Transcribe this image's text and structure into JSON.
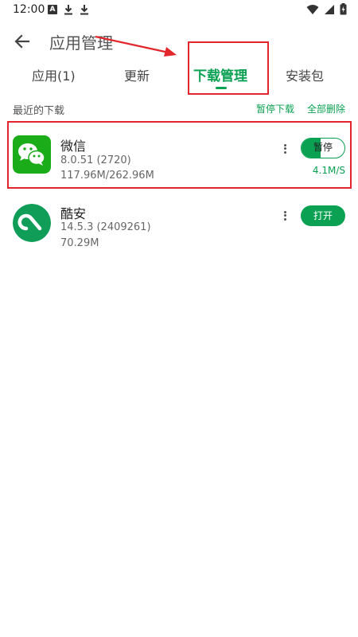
{
  "status_bar": {
    "time": "12:00",
    "left_icons": [
      "a-notification-icon",
      "download-icon",
      "download-icon"
    ],
    "right_icons": [
      "wifi-icon",
      "signal-icon",
      "battery-icon"
    ]
  },
  "header": {
    "title": "应用管理",
    "back_icon": "arrow-left-icon"
  },
  "tabs": [
    {
      "label": "应用(1)",
      "active": false
    },
    {
      "label": "更新",
      "active": false
    },
    {
      "label": "下载管理",
      "active": true
    },
    {
      "label": "安装包",
      "active": false
    }
  ],
  "section": {
    "title": "最近的下载",
    "pause_all": "暂停下载",
    "delete_all": "全部删除"
  },
  "downloads": [
    {
      "name": "微信",
      "version": "8.0.51 (2720)",
      "size": "117.96M/262.96M",
      "progress": 0.45,
      "action_label": "暂停",
      "speed": "4.1M/S",
      "icon": "wechat-icon"
    },
    {
      "name": "酷安",
      "version": "14.5.3 (2409261)",
      "size": "70.29M",
      "action_label": "打开",
      "icon": "coolapk-icon"
    }
  ],
  "colors": {
    "accent": "#0aa152",
    "annotation": "#e3262c",
    "wechat": "#1aad19",
    "coolapk": "#0f9d58"
  }
}
